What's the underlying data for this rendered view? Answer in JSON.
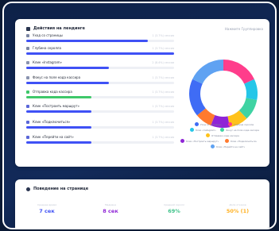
{
  "actions": {
    "title": "Действия на лендинге",
    "period": "Нажмите Группировка",
    "rows": [
      {
        "label": "Уход со страницы",
        "meta": "1 (3.7%) сессия",
        "fill": 0.82,
        "color": "#3f51f5",
        "icon_color": "#7b86a3",
        "icon": "exit-icon"
      },
      {
        "label": "Глубина скролла",
        "meta": "1 (3.7%) сессия",
        "fill": 1.0,
        "color": "#3f51f5",
        "icon_color": "#7b86a3",
        "icon": "scroll-icon"
      },
      {
        "label": "Клик «Instagram»",
        "meta": "2 (8.4%) сессии",
        "fill": 0.56,
        "color": "#3f51f5",
        "icon_color": "#8a93b0",
        "icon": "instagram-icon"
      },
      {
        "label": "Фокус на поле кода кассира",
        "meta": "1 (3.7%) сессия",
        "fill": 0.56,
        "color": "#3f51f5",
        "icon_color": "#8a93b0",
        "icon": "focus-icon"
      },
      {
        "label": "Отправка кода кассира",
        "meta": "1 (3.7%) сессия",
        "fill": 0.44,
        "color": "#3fc86a",
        "icon_color": "#3fc86a",
        "icon": "check-icon"
      },
      {
        "label": "Клик «Построить маршрут»",
        "meta": "1 (3.7%) сессия",
        "fill": 0.44,
        "color": "#3f51f5",
        "icon_color": "#5a67d8",
        "icon": "route-icon"
      },
      {
        "label": "Клик «Подключиться»",
        "meta": "1 (3.7%) сессия",
        "fill": 0.44,
        "color": "#3f51f5",
        "icon_color": "#5a67d8",
        "icon": "connect-icon"
      },
      {
        "label": "Клик «Перейти на сайт»",
        "meta": "1 (3.7%) сессия",
        "fill": 0.44,
        "color": "#3f51f5",
        "icon_color": "#5a67d8",
        "icon": "link-icon"
      }
    ],
    "donut": [
      {
        "share": 0.18,
        "color": "#ff3d8b"
      },
      {
        "share": 0.1,
        "color": "#25c6e8"
      },
      {
        "share": 0.1,
        "color": "#3fd3a3"
      },
      {
        "share": 0.09,
        "color": "#ffc21a"
      },
      {
        "share": 0.09,
        "color": "#8f25d6"
      },
      {
        "share": 0.08,
        "color": "#ff7a2f"
      },
      {
        "share": 0.18,
        "color": "#3f6cf5"
      },
      {
        "share": 0.18,
        "color": "#5fa2f2"
      }
    ],
    "legend": [
      {
        "label": "Уход со страницы",
        "color": "#3f6cf5"
      },
      {
        "label": "Глубина скролла",
        "color": "#ff3d8b"
      },
      {
        "label": "Клик «Instagram»",
        "color": "#25c6e8"
      },
      {
        "label": "Фокус на поле кода кассира",
        "color": "#3fd3a3"
      },
      {
        "label": "Отправка кода кассира",
        "color": "#ffc21a"
      },
      {
        "label": "Клик «Построить маршрут»",
        "color": "#8f25d6"
      },
      {
        "label": "Клик «Подключиться»",
        "color": "#ff7a2f"
      },
      {
        "label": "Клик «Перейти на сайт»",
        "color": "#5fa2f2"
      }
    ]
  },
  "behavior": {
    "title": "Поведение на странице",
    "metrics": [
      {
        "label": "Среднее время",
        "value": "7 сек",
        "color": "#3f51f5"
      },
      {
        "label": "Медиана",
        "value": "8 сек",
        "color": "#8f25d6"
      },
      {
        "label": "Средний скролл",
        "value": "69%",
        "color": "#3fc28a"
      },
      {
        "label": "Доля отказов",
        "value": "50% (1)",
        "color": "#ffb020"
      }
    ]
  }
}
